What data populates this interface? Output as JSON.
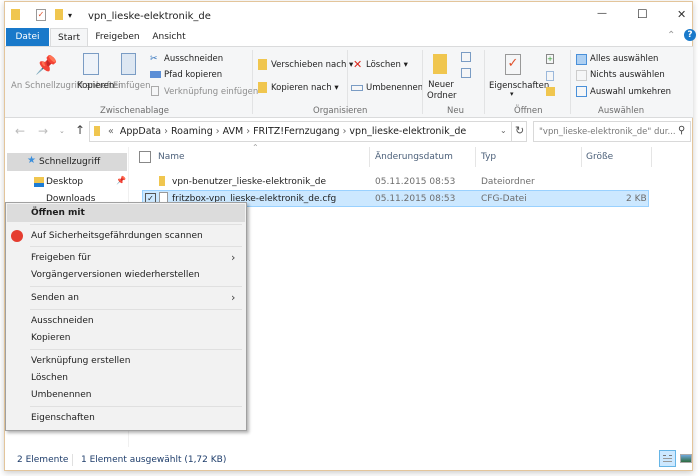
{
  "window": {
    "title": "vpn_lieske-elektronik_de",
    "minimize": "—",
    "maximize": "☐",
    "close": "✕"
  },
  "tabs": [
    "Datei",
    "Start",
    "Freigeben",
    "Ansicht"
  ],
  "ribbon": {
    "zwischenablage": {
      "label": "Zwischenablage",
      "pin": "An Schnellzugriff anheften",
      "kopieren": "Kopieren",
      "einfuegen": "Einfügen",
      "ausschneiden": "Ausschneiden",
      "pfad": "Pfad kopieren",
      "verknuepfung": "Verknüpfung einfügen"
    },
    "organisieren": {
      "label": "Organisieren",
      "verschieben": "Verschieben nach",
      "kopieren": "Kopieren nach",
      "loeschen": "Löschen",
      "umbenennen": "Umbenennen"
    },
    "neu": {
      "label": "Neu",
      "neuer_ordner": "Neuer Ordner"
    },
    "oeffnen": {
      "label": "Öffnen",
      "eigenschaften": "Eigenschaften"
    },
    "auswaehlen": {
      "label": "Auswählen",
      "alles": "Alles auswählen",
      "nichts": "Nichts auswählen",
      "umkehren": "Auswahl umkehren"
    }
  },
  "address": {
    "breadcrumb": [
      "AppData",
      "Roaming",
      "AVM",
      "FRITZ!Fernzugang",
      "vpn_lieske-elektronik_de"
    ],
    "search_placeholder": "\"vpn_lieske-elektronik_de\" dur..."
  },
  "nav": {
    "items": [
      "Schnellzugriff",
      "Desktop",
      "Downloads"
    ]
  },
  "columns": {
    "name": "Name",
    "date": "Änderungsdatum",
    "type": "Typ",
    "size": "Größe"
  },
  "files": [
    {
      "name": "vpn-benutzer_lieske-elektronik_de",
      "date": "05.11.2015 08:53",
      "type": "Dateiordner",
      "size": ""
    },
    {
      "name": "fritzbox-vpn_lieske-elektronik_de.cfg",
      "date": "05.11.2015 08:53",
      "type": "CFG-Datei",
      "size": "2 KB"
    }
  ],
  "context_menu": [
    "Öffnen mit",
    "Auf Sicherheitsgefährdungen scannen",
    "Freigeben für",
    "Vorgängerversionen wiederherstellen",
    "Senden an",
    "Ausschneiden",
    "Kopieren",
    "Verknüpfung erstellen",
    "Löschen",
    "Umbenennen",
    "Eigenschaften"
  ],
  "status": {
    "count": "2 Elemente",
    "selected": "1 Element ausgewählt (1,72 KB)"
  },
  "colors": {
    "accent": "#1979ca",
    "selection": "#cce8ff",
    "border": "#e3c59b"
  }
}
